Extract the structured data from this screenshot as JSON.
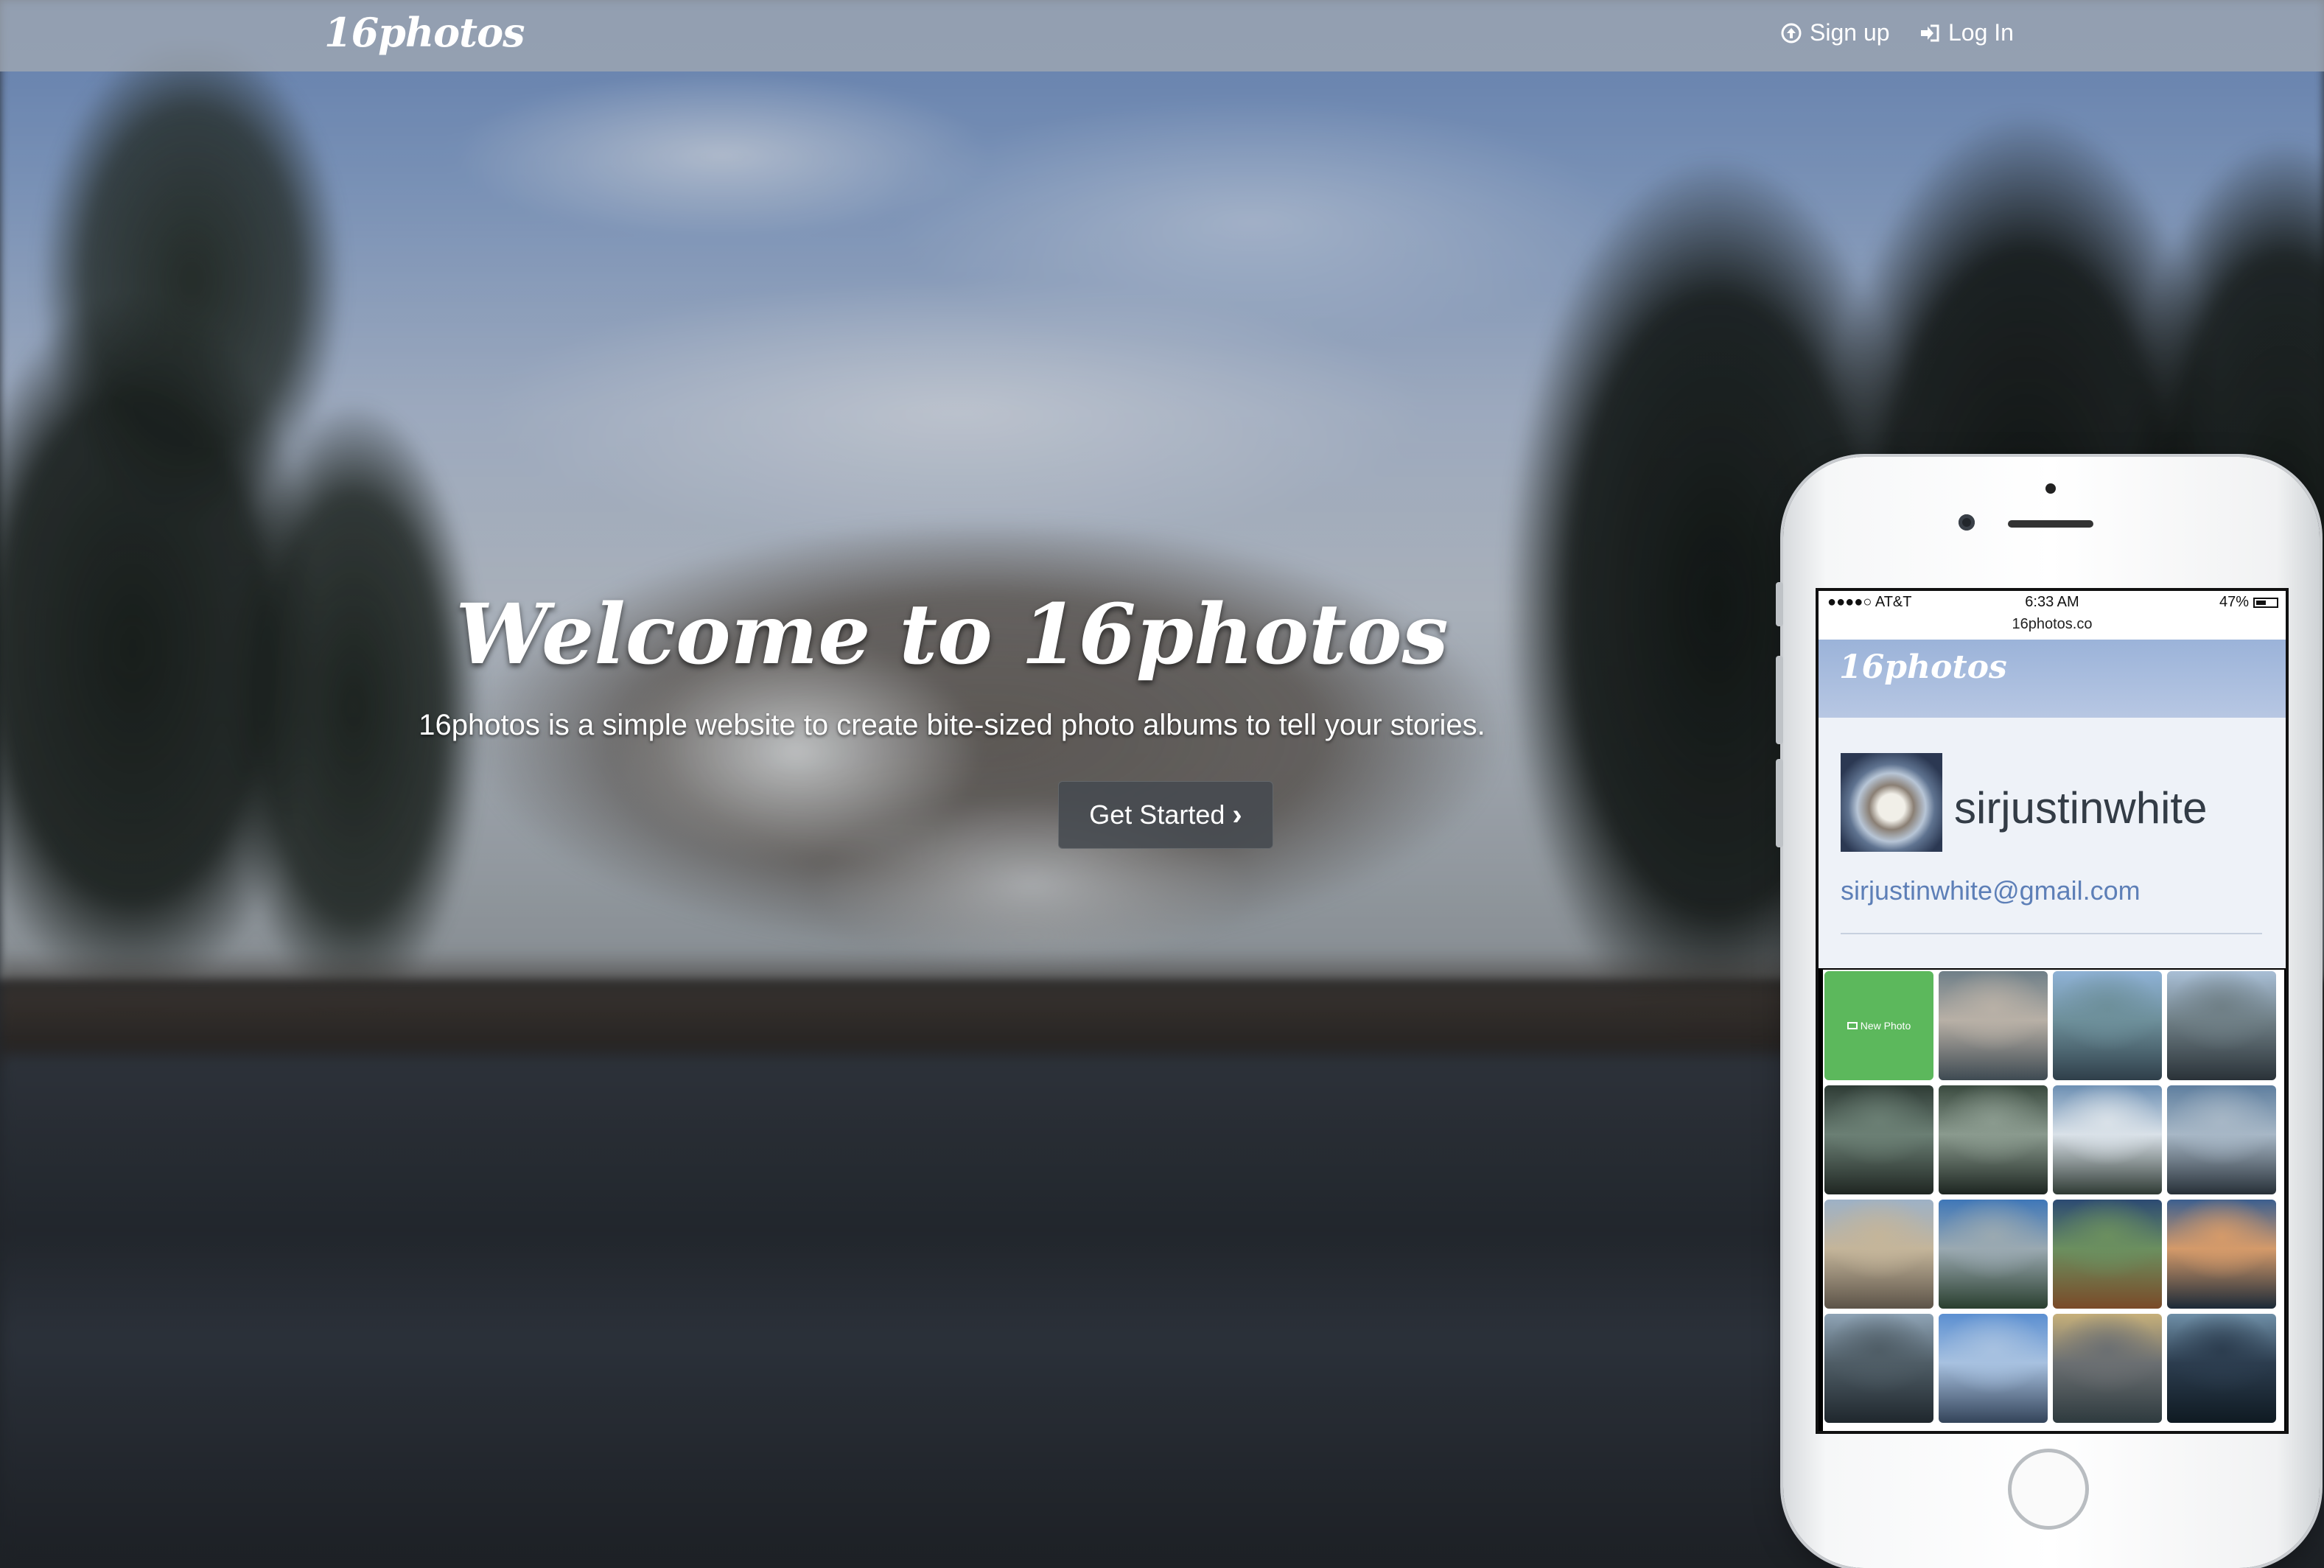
{
  "navbar": {
    "brand": "16photos",
    "links": [
      {
        "label": "Sign up",
        "icon": "arrow-circle-up-icon"
      },
      {
        "label": "Log In",
        "icon": "sign-in-icon"
      }
    ]
  },
  "hero": {
    "title": "Welcome to 16photos",
    "subtitle": "16photos is a simple website to create bite-sized photo albums to tell your stories.",
    "cta_label": "Get Started",
    "cta_icon": "chevron-right-icon"
  },
  "phone": {
    "status": {
      "carrier": "●●●●○ AT&T",
      "time": "6:33 AM",
      "battery": "47%"
    },
    "url": "16photos.co",
    "app_brand": "16photos",
    "profile": {
      "username": "sirjustinwhite",
      "email": "sirjustinwhite@gmail.com"
    },
    "grid": {
      "new_photo_label": "New Photo",
      "tiles": [
        {
          "colors": [
            "#6f7f88",
            "#b8b0a6",
            "#3e4a52"
          ]
        },
        {
          "colors": [
            "#8fb2d6",
            "#6d8f9a",
            "#2f3f4a"
          ]
        },
        {
          "colors": [
            "#a9bfd6",
            "#6f7f86",
            "#2a3238"
          ]
        },
        {
          "colors": [
            "#2e3b35",
            "#6b7f74",
            "#1f2622"
          ]
        },
        {
          "colors": [
            "#3a4a3f",
            "#8a9a8e",
            "#1d2621"
          ]
        },
        {
          "colors": [
            "#6c8fb3",
            "#d9e1e8",
            "#2f3a34"
          ]
        },
        {
          "colors": [
            "#5f7f9f",
            "#a7b7c6",
            "#273038"
          ]
        },
        {
          "colors": [
            "#9db1c6",
            "#c4b59a",
            "#5c5348"
          ]
        },
        {
          "colors": [
            "#3f77b8",
            "#9aa9b1",
            "#2a3f2f"
          ]
        },
        {
          "colors": [
            "#2c4a73",
            "#6b8f5f",
            "#7a4a28"
          ]
        },
        {
          "colors": [
            "#3c5f8f",
            "#d49a6a",
            "#1c2a38"
          ]
        },
        {
          "colors": [
            "#8fa4b6",
            "#4f5d66",
            "#1f272d"
          ]
        },
        {
          "colors": [
            "#5b8fd1",
            "#a7c1e0",
            "#34445a"
          ]
        },
        {
          "colors": [
            "#c7b07a",
            "#6b6f72",
            "#2e3a3e"
          ]
        },
        {
          "colors": [
            "#6f8fa7",
            "#2c3d4f",
            "#0f1a22"
          ]
        }
      ]
    }
  }
}
